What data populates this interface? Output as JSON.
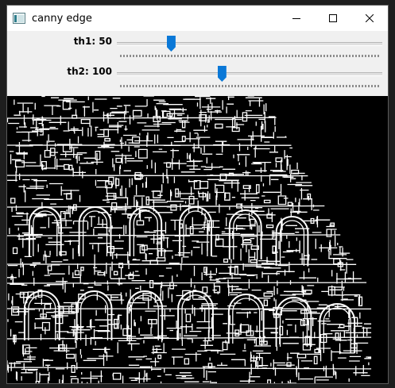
{
  "window": {
    "title": "canny edge"
  },
  "titlebar_icons": {
    "app": "app-window-icon",
    "minimize": "minimize-icon",
    "maximize": "maximize-icon",
    "close": "close-icon"
  },
  "trackbars": [
    {
      "label": "th1: 50",
      "value": 50,
      "max": 255
    },
    {
      "label": "th2: 100",
      "value": 100,
      "max": 255
    }
  ],
  "colors": {
    "thumb": "#0a78d7",
    "edges": "#ffffff",
    "background": "#000000"
  }
}
